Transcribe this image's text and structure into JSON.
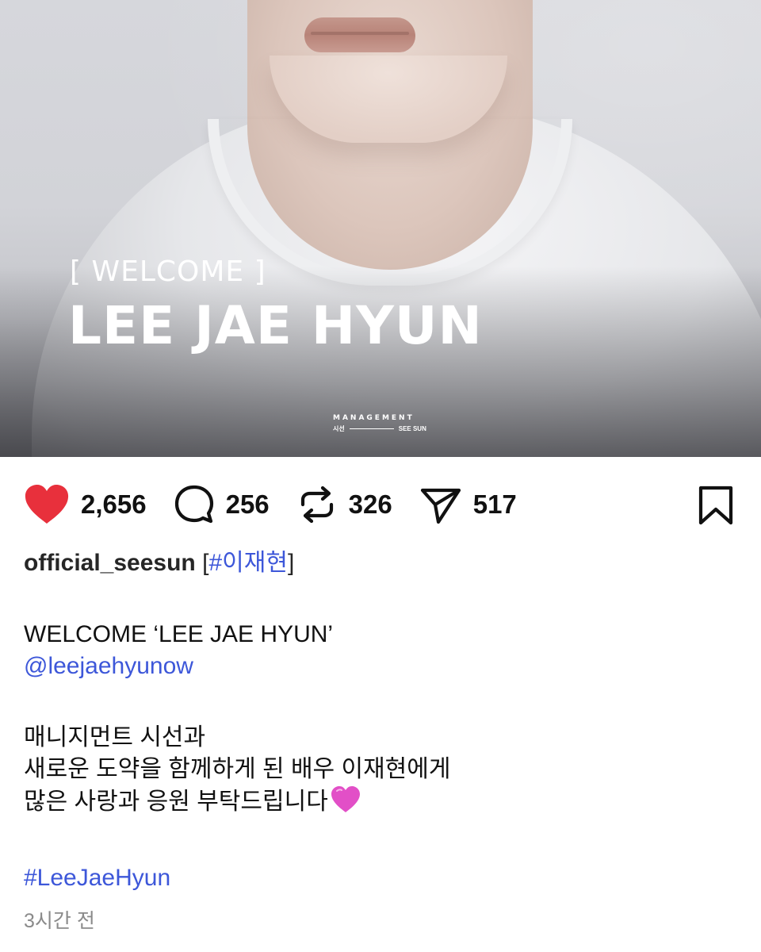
{
  "post_image": {
    "overlay_welcome": "[ WELCOME ]",
    "overlay_name": "LEE JAE HYUN",
    "brand_top": "MANAGEMENT",
    "brand_left": "시선",
    "brand_right": "SEE SUN"
  },
  "actions": {
    "likes": "2,656",
    "comments": "256",
    "reposts": "326",
    "shares": "517",
    "icons": [
      "heart-icon",
      "comment-icon",
      "repost-icon",
      "share-icon",
      "bookmark-icon"
    ],
    "like_color": "#e8303c"
  },
  "caption": {
    "username": "official_seesun",
    "bracket_open": "[",
    "hashtag_top": "#이재현",
    "bracket_close": "]",
    "line1": "WELCOME ‘LEE JAE HYUN’",
    "mention": "@leejaehyunow",
    "line2": "매니지먼트 시선과",
    "line3": "새로운 도약을 함께하게 된 배우 이재현에게",
    "line4": "많은 사랑과 응원 부탁드립니다",
    "hashtag_bottom": "#LeeJaeHyun",
    "timestamp": "3시간 전",
    "link_color": "#3d57d9"
  }
}
